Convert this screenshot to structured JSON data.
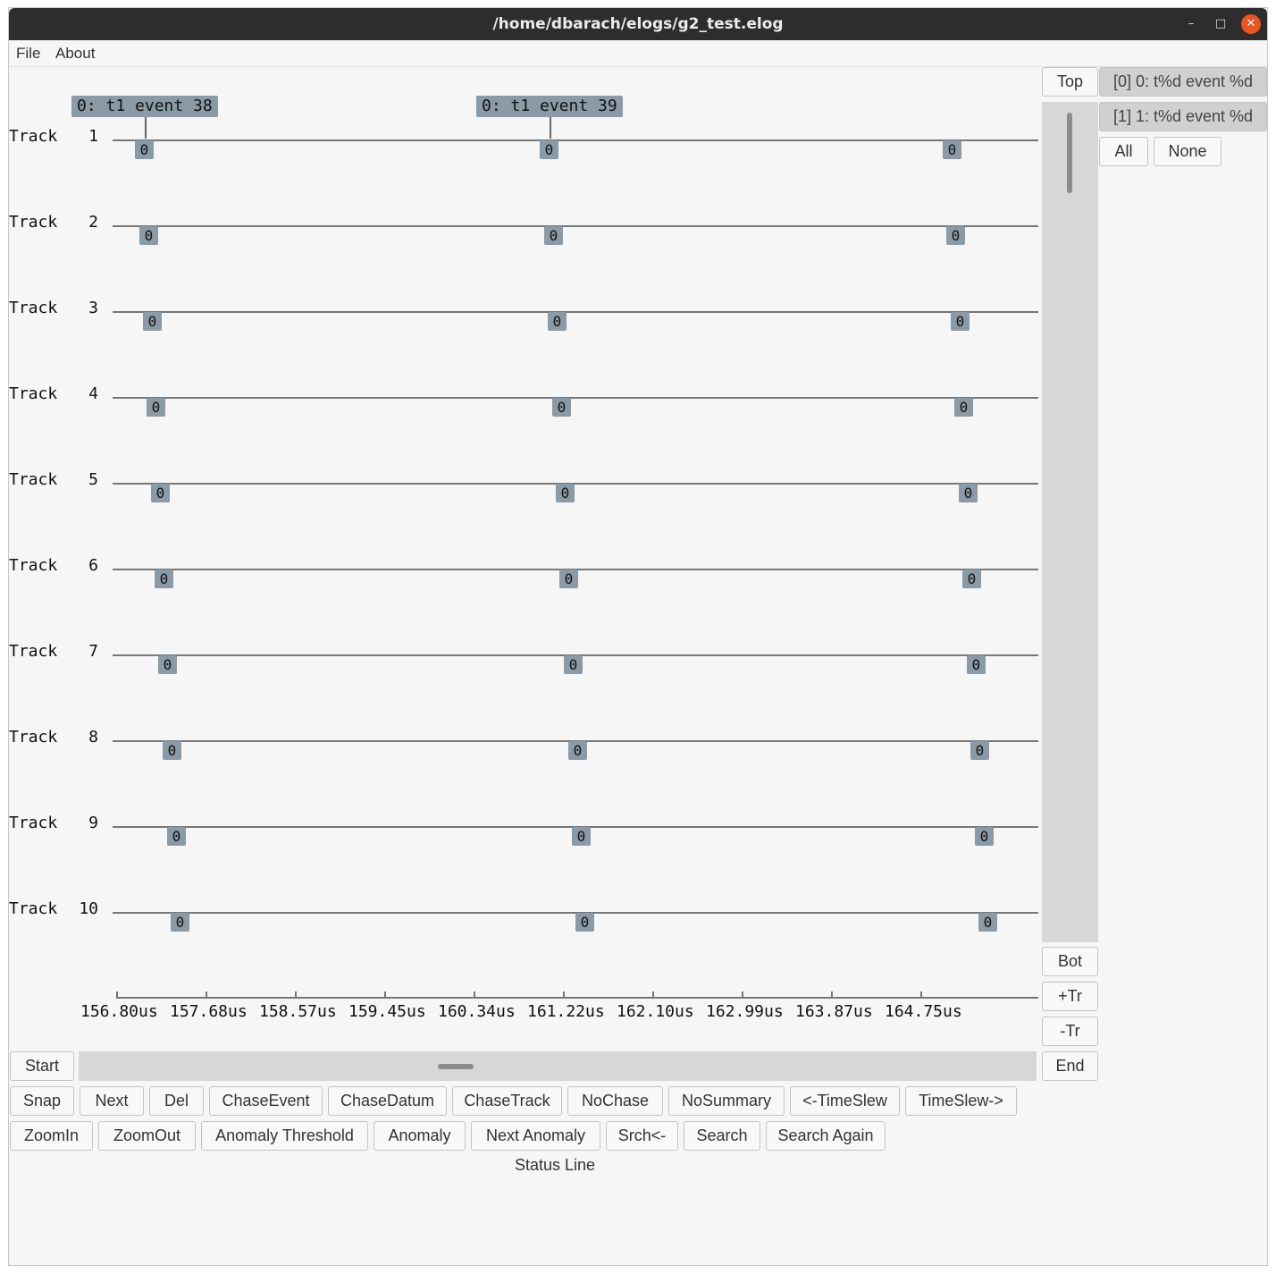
{
  "window": {
    "title": "/home/dbarach/elogs/g2_test.elog",
    "controls": {
      "minimize": "–",
      "maximize": "□",
      "close": "✕"
    }
  },
  "menu": [
    "File",
    "About"
  ],
  "track_label": "Track",
  "tracks": [
    "1",
    "2",
    "3",
    "4",
    "5",
    "6",
    "7",
    "8",
    "9",
    "10"
  ],
  "event_glyph": "0",
  "selected_events": [
    "0: t1 event 38",
    "0: t1 event 39"
  ],
  "time_axis": [
    "156.80us",
    "157.68us",
    "158.57us",
    "159.45us",
    "160.34us",
    "161.22us",
    "162.10us",
    "162.99us",
    "163.87us",
    "164.75us"
  ],
  "right_panel": {
    "top": "Top",
    "bot": "Bot",
    "add_track": "+Tr",
    "remove_track": "-Tr",
    "end": "End"
  },
  "filters": {
    "items": [
      "[0] 0: t%d event %d",
      "[1] 1: t%d event %d"
    ],
    "all": "All",
    "none": "None"
  },
  "start": "Start",
  "toolbar_row1": [
    "Snap",
    "Next",
    "Del",
    "ChaseEvent",
    "ChaseDatum",
    "ChaseTrack",
    "NoChase",
    "NoSummary",
    "<-TimeSlew",
    "TimeSlew->"
  ],
  "toolbar_row2": [
    "ZoomIn",
    "ZoomOut",
    "Anomaly Threshold",
    "Anomaly",
    "Next Anomaly",
    "Srch<-",
    "Search",
    "Search Again"
  ],
  "status": "Status Line",
  "colors": {
    "titlebar": "#2d2d2d",
    "event": "#8a9aa6",
    "close": "#e95420",
    "background": "#f6f6f6"
  }
}
